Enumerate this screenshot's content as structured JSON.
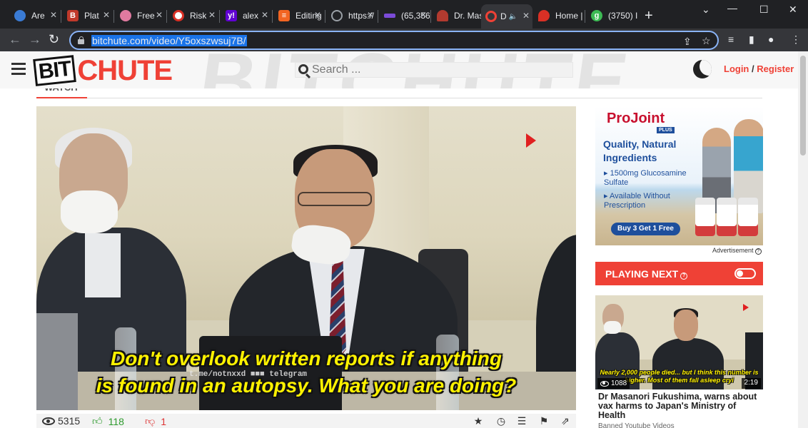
{
  "browser": {
    "tabs": [
      {
        "title": "Are",
        "favicon": "globe-blue",
        "color": "#3a7bd5"
      },
      {
        "title": "Plat",
        "favicon": "bi",
        "color": "#c0392b"
      },
      {
        "title": "Free",
        "favicon": "pink-flower",
        "color": "#e07aa0"
      },
      {
        "title": "Risk",
        "favicon": "red-circle",
        "color": "#d93025"
      },
      {
        "title": "alex",
        "favicon": "yahoo",
        "color": "#6001d2"
      },
      {
        "title": "Editing",
        "favicon": "orange-doc",
        "color": "#f26522"
      },
      {
        "title": "https://",
        "favicon": "globe-grey",
        "color": "#9aa0a6"
      },
      {
        "title": "(65,356",
        "favicon": "purple-bar",
        "color": "#7b4bd8"
      },
      {
        "title": "Dr. Mas",
        "favicon": "person-dark",
        "color": "#b23a2f"
      },
      {
        "title": "D",
        "favicon": "bitchute-red",
        "color": "#ef4136",
        "audio": "🔈"
      },
      {
        "title": "Home |",
        "favicon": "red-pin",
        "color": "#d93025"
      },
      {
        "title": "(3750) I",
        "favicon": "green-g",
        "color": "#3cba54"
      }
    ],
    "new_tab": "+",
    "window_controls": {
      "chevron": "⌄",
      "minimize": "—",
      "maximize": "☐",
      "close": "✕"
    },
    "nav": {
      "back": "←",
      "forward": "→",
      "reload": "↻"
    },
    "url": "bitchute.com/video/Y5oxszwsuj7B/",
    "toolbar_icons": {
      "share": "⇪",
      "bookmark": "☆",
      "reading_list": "≡",
      "sidepanel": "▮",
      "profile": "●",
      "menu": "⋮"
    }
  },
  "site": {
    "logo_bit": "BIT",
    "logo_chute": "CHUTE",
    "search_placeholder": "Search ...",
    "login": "Login",
    "separator": "/",
    "register": "Register"
  },
  "video": {
    "subtitle_line1": "Don't overlook written reports if anything",
    "subtitle_line2": "is found in an autopsy. What you are doing?",
    "watermark": "t.me/notnxxd ■■■ telegram",
    "views": "5315",
    "likes": "118",
    "dislikes": "1",
    "icons": {
      "favorite": "★",
      "watch_later": "◷",
      "playlist": "☰",
      "flag": "⚑",
      "share": "⇗"
    }
  },
  "ad": {
    "brand": "ProJoint",
    "plus": "PLUS",
    "headline": "Quality, Natural Ingredients",
    "bullet1": "1500mg Glucosamine Sulfate",
    "bullet2": "Available Without Prescription",
    "cta": "Buy 3 Get 1 Free",
    "label": "Advertisement"
  },
  "playing_next": {
    "label": "PLAYING NEXT",
    "help": "?",
    "next_video": {
      "caption": "Nearly 2,000 people died... but I think this number is higher. Most of them fall asleep cryi",
      "views": "1088",
      "duration": "2:19",
      "title": "Dr Masanori Fukushima, warns about vax harms to Japan's Ministry of Health",
      "channel": "Banned Youtube Videos"
    }
  }
}
